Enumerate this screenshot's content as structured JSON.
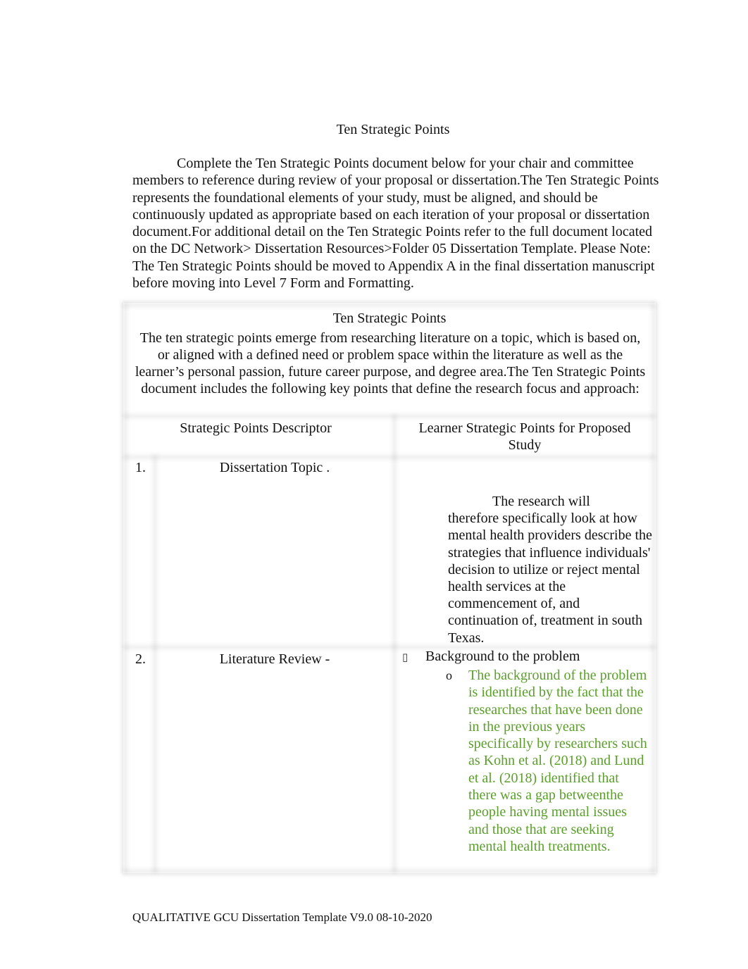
{
  "document": {
    "title": "Ten Strategic Points",
    "intro_paragraph": "Complete the Ten Strategic Points document below for your chair and committee members to reference during review of your proposal or dissertation.The Ten Strategic Points represents the foundational elements of your study, must be aligned, and should be continuously updated as appropriate based on each iteration of your proposal or dissertation document.For additional detail on the Ten Strategic Points refer to the full document located on the DC Network> Dissertation Resources>Folder 05 Dissertation Template. Please Note: The Ten Strategic Points should be moved to Appendix A in the final dissertation manuscript before moving into Level 7 Form and Formatting."
  },
  "table": {
    "heading": "Ten Strategic Points",
    "description": "The ten strategic points emerge from researching literature on a topic, which is based on, or aligned with a defined need or problem space within the literature as well as the learner’s personal passion, future career purpose, and degree area.The Ten Strategic Points document includes the following key points that define the research focus and approach:",
    "column_headers": {
      "left": "Strategic Points Descriptor",
      "right": "Learner Strategic Points for Proposed Study"
    },
    "rows": [
      {
        "number": "1.",
        "descriptor": "Dissertation Topic  .",
        "content_first_line": "The research will",
        "content_rest": "therefore specifically look at how mental health providers describe the strategies that influence individuals' decision to utilize or reject mental health services at the commencement of, and continuation of, treatment in south Texas."
      },
      {
        "number": "2.",
        "descriptor": "Literature Review   -",
        "bullet_icon": "▯",
        "bullet_label": "Background to the problem",
        "sub_bullet_icon": "o",
        "sub_bullet_text": "The background of the problem is identified by the fact that the researches that have been done in the previous years specifically by researchers such as Kohn et al. (2018) and Lund et al. (2018) identified that there was a gap betweenthe people having mental issues and those that are seeking mental health treatments."
      }
    ]
  },
  "colors": {
    "body_text": "#111111",
    "highlight_green": "#5a9f2a"
  },
  "footer": {
    "text": "QUALITATIVE GCU Dissertation Template V9.0 08-10-2020"
  }
}
